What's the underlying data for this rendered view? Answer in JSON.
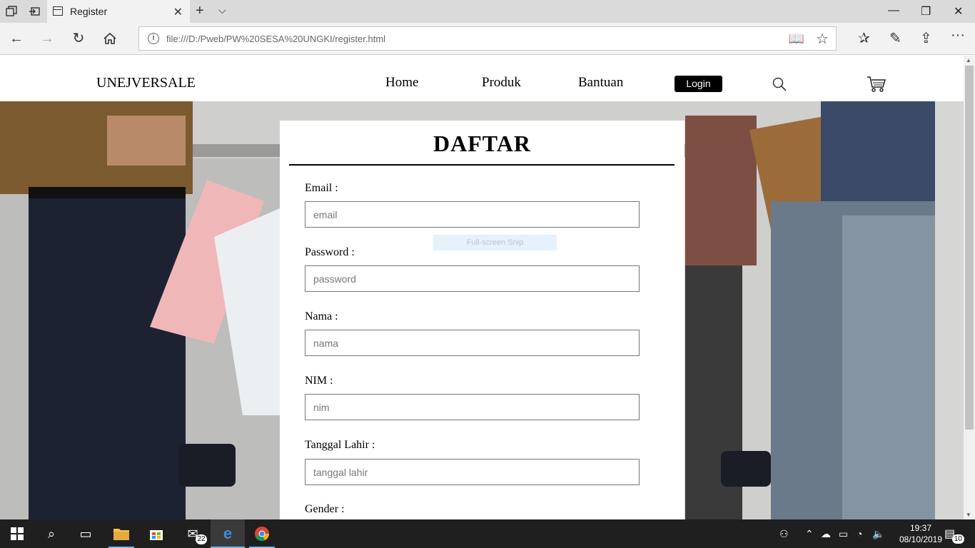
{
  "browser": {
    "tab_title": "Register",
    "url": "file:///D:/Pweb/PW%20SESA%20UNGKI/register.html",
    "icons": [
      "tab-actions-icon",
      "set-aside-icon",
      "page-icon",
      "close-icon",
      "new-tab-icon",
      "tab-preview-chevron-icon",
      "minimize-icon",
      "restore-icon",
      "window-close-icon",
      "back-icon",
      "forward-icon",
      "refresh-icon",
      "home-icon",
      "info-icon",
      "reading-view-icon",
      "favorite-star-icon",
      "favorites-hub-icon",
      "pen-icon",
      "share-icon",
      "more-icon"
    ]
  },
  "site": {
    "brand": "UNEJVERSALE",
    "nav": {
      "home": "Home",
      "produk": "Produk",
      "bantuan": "Bantuan",
      "login": "Login"
    }
  },
  "form": {
    "title": "DAFTAR",
    "fields": [
      {
        "label": "Email :",
        "placeholder": "email"
      },
      {
        "label": "Password :",
        "placeholder": "password"
      },
      {
        "label": "Nama :",
        "placeholder": "nama"
      },
      {
        "label": "NIM :",
        "placeholder": "nim"
      },
      {
        "label": "Tanggal Lahir :",
        "placeholder": "tanggal lahir"
      },
      {
        "label": "Gender :"
      }
    ]
  },
  "overlay": {
    "snip_label": "Full-screen Snip"
  },
  "taskbar": {
    "mail_badge": "22",
    "time": "19:37",
    "date": "08/10/2019",
    "notifications": "10"
  },
  "colors": {
    "accent": "#000000",
    "taskbar": "#1f1f1f",
    "taskbar_highlight": "#76b9ed"
  }
}
